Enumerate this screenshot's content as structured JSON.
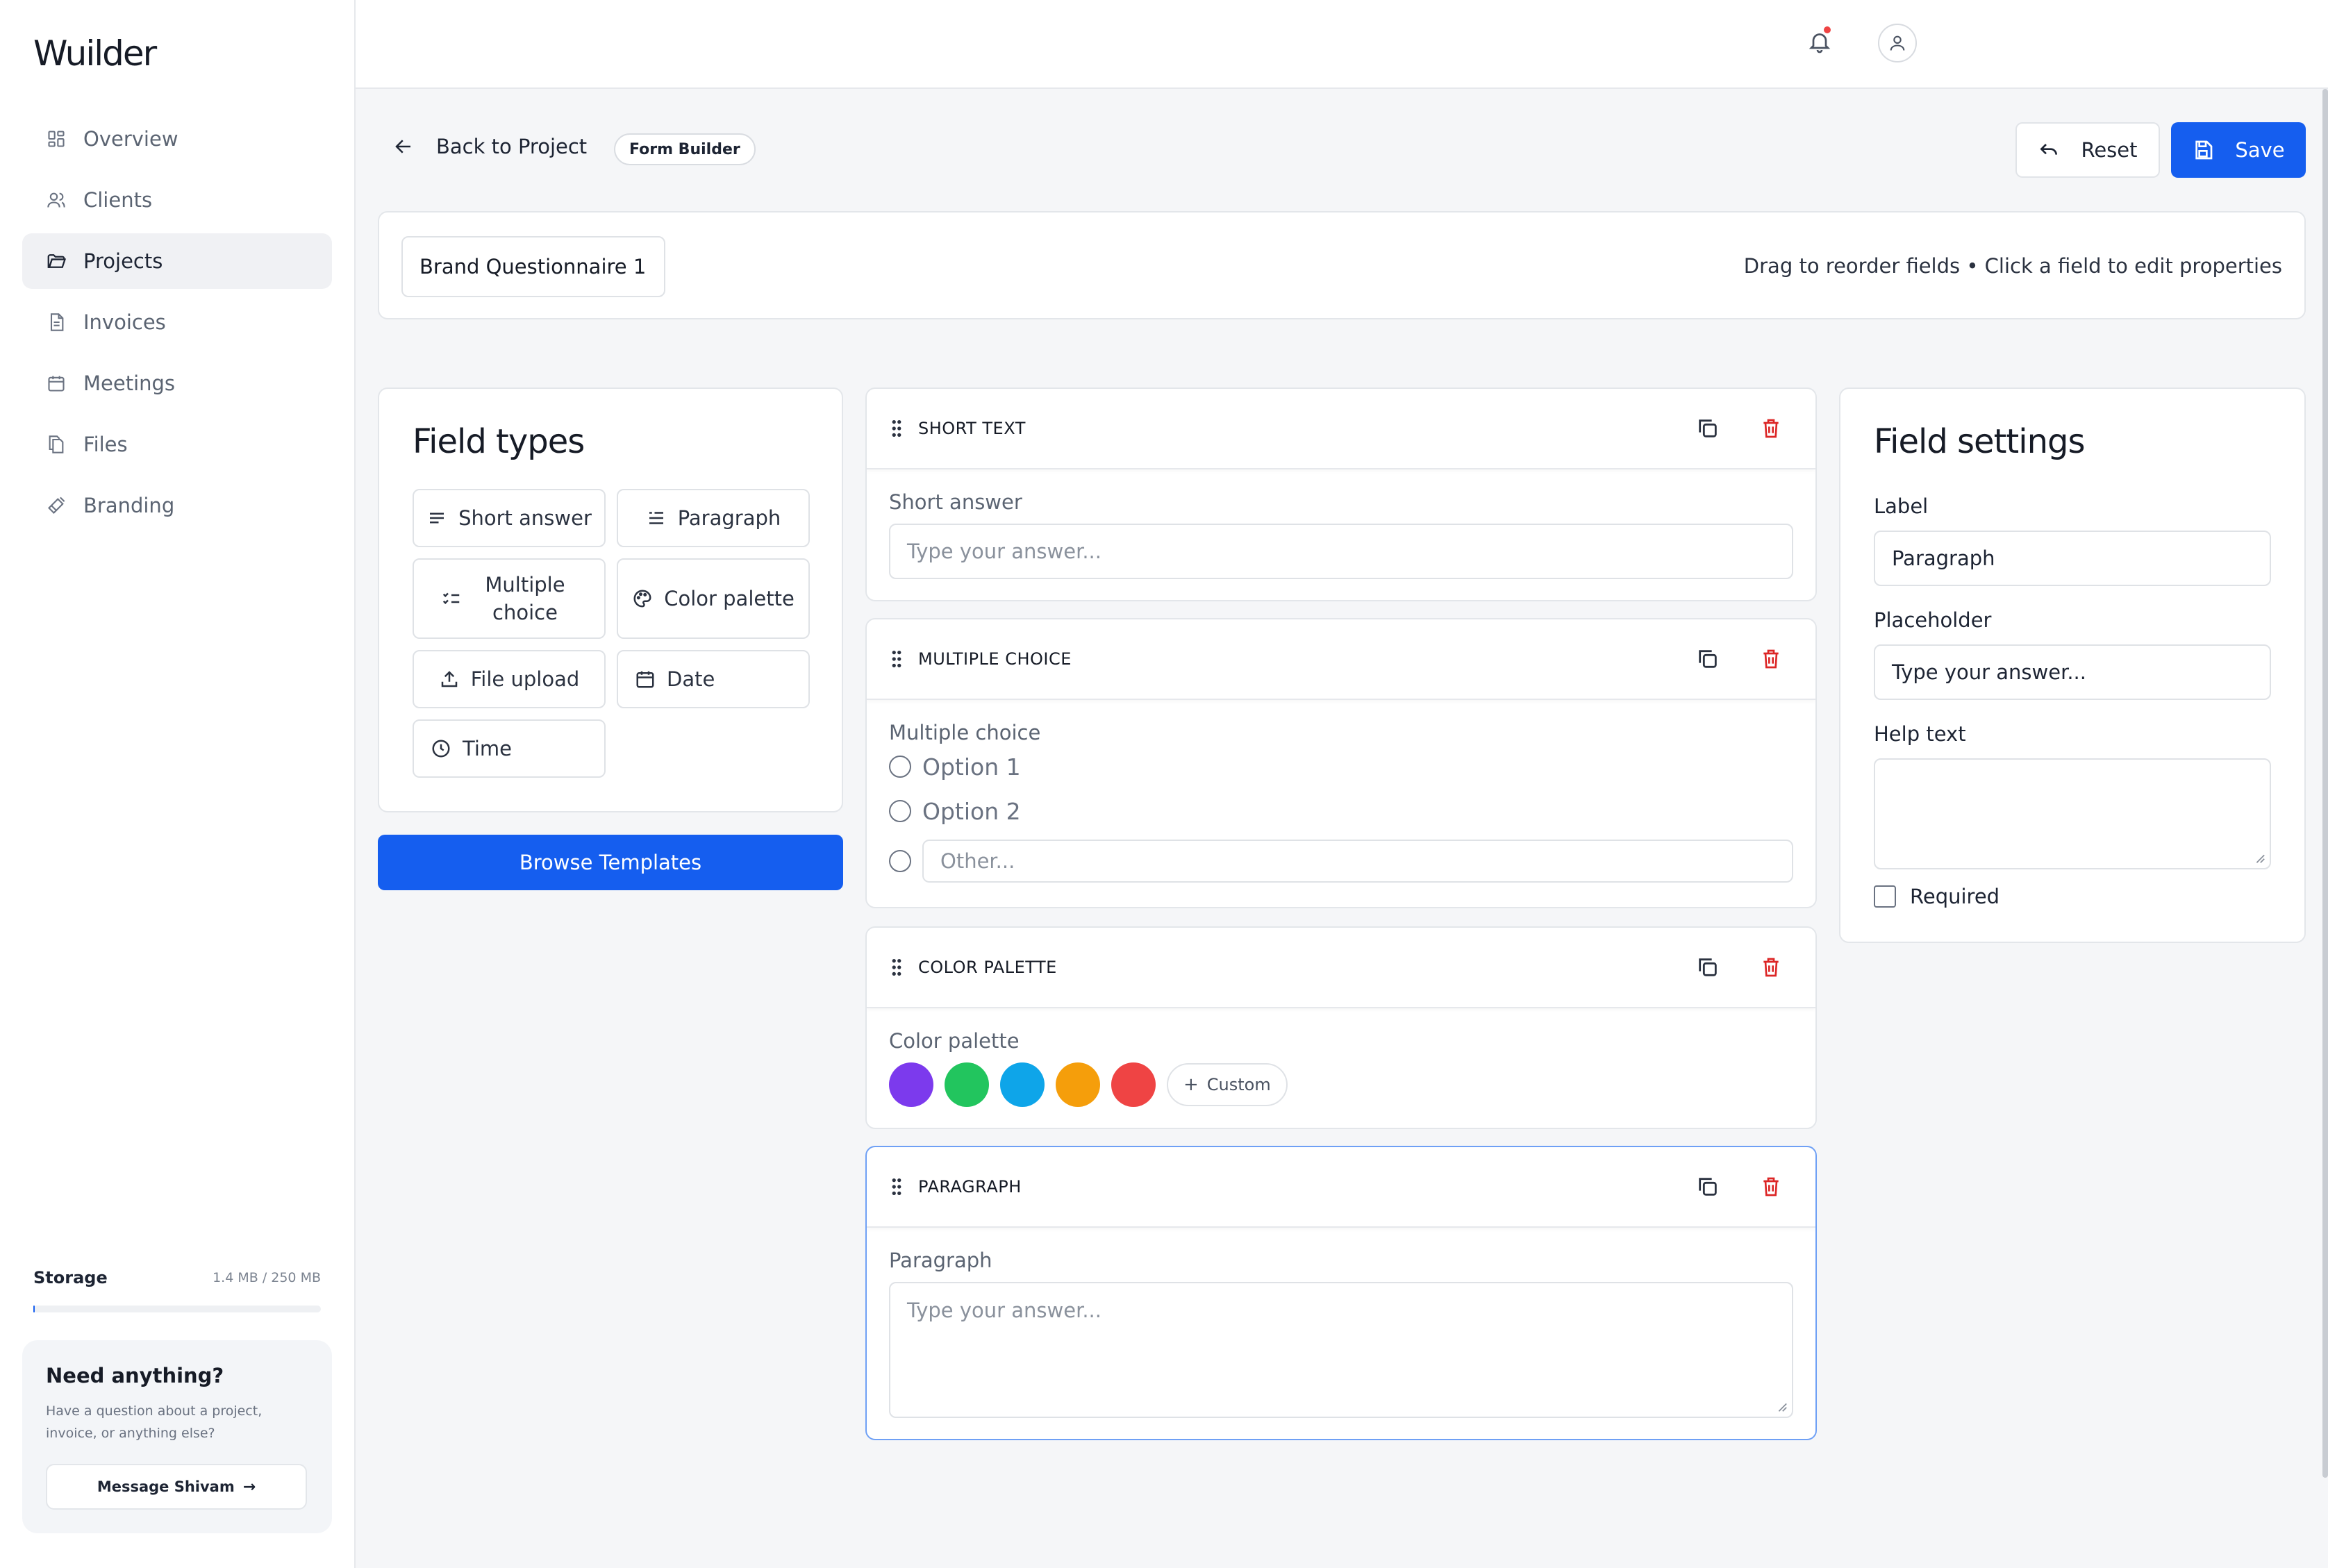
{
  "app": {
    "name": "Wuilder"
  },
  "nav": [
    {
      "label": "Overview",
      "icon": "grid-icon"
    },
    {
      "label": "Clients",
      "icon": "users-icon"
    },
    {
      "label": "Projects",
      "icon": "folder-icon",
      "active": true
    },
    {
      "label": "Invoices",
      "icon": "document-icon"
    },
    {
      "label": "Meetings",
      "icon": "calendar-icon"
    },
    {
      "label": "Files",
      "icon": "files-icon"
    },
    {
      "label": "Branding",
      "icon": "brush-icon"
    }
  ],
  "storage": {
    "label": "Storage",
    "value": "1.4 MB / 250 MB",
    "used_fraction": 0.0056
  },
  "help": {
    "title": "Need anything?",
    "text": "Have a question about a project, invoice, or anything else?",
    "button": "Message Shivam"
  },
  "header": {
    "back": "Back to Project",
    "badge": "Form Builder",
    "reset": "Reset",
    "save": "Save"
  },
  "form": {
    "name": "Brand Questionnaire 1",
    "hint": "Drag to reorder fields • Click a field to edit properties"
  },
  "field_types": {
    "title": "Field types",
    "items": [
      {
        "label": "Short answer",
        "icon": "short-answer-icon"
      },
      {
        "label": "Paragraph",
        "icon": "paragraph-icon"
      },
      {
        "label": "Multiple choice",
        "icon": "checklist-icon"
      },
      {
        "label": "Color palette",
        "icon": "palette-icon"
      },
      {
        "label": "File upload",
        "icon": "upload-icon"
      },
      {
        "label": "Date",
        "icon": "calendar-icon"
      },
      {
        "label": "Time",
        "icon": "clock-icon"
      }
    ],
    "browse": "Browse Templates"
  },
  "fields": [
    {
      "type": "SHORT TEXT",
      "label": "Short answer",
      "placeholder": "Type your answer..."
    },
    {
      "type": "MULTIPLE CHOICE",
      "label": "Multiple choice",
      "options": [
        "Option 1",
        "Option 2"
      ],
      "other_placeholder": "Other..."
    },
    {
      "type": "COLOR PALETTE",
      "label": "Color palette",
      "colors": [
        "#7c3aed",
        "#22c55e",
        "#0ea5e9",
        "#f59e0b",
        "#ef4444"
      ],
      "custom": "Custom"
    },
    {
      "type": "PARAGRAPH",
      "label": "Paragraph",
      "placeholder": "Type your answer...",
      "selected": true
    }
  ],
  "settings": {
    "title": "Field settings",
    "label_label": "Label",
    "label_value": "Paragraph",
    "placeholder_label": "Placeholder",
    "placeholder_value": "Type your answer...",
    "help_label": "Help text",
    "help_value": "",
    "required_label": "Required",
    "required": false
  },
  "colors": {
    "accent": "#155eef",
    "danger": "#dc2626",
    "notification": "#ef4444"
  }
}
